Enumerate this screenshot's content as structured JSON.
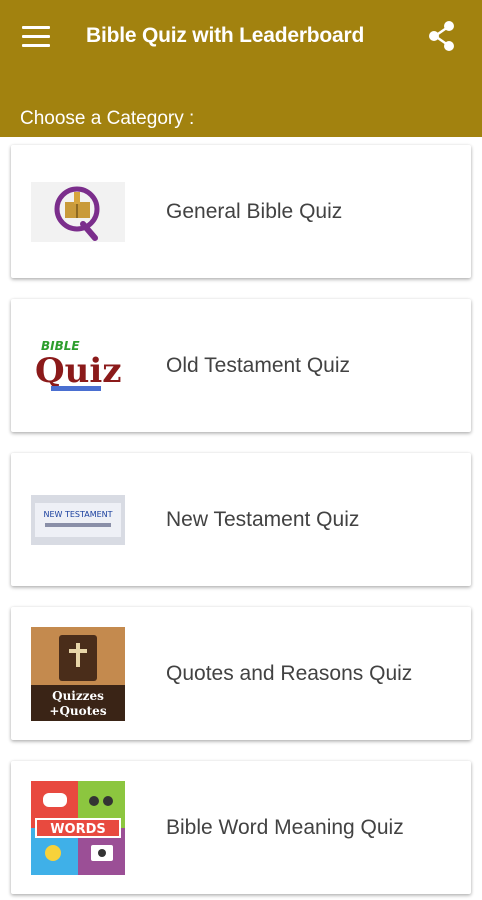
{
  "app_bar": {
    "title": "Bible Quiz with Leaderboard",
    "menu_icon": "hamburger-menu-icon",
    "share_icon": "share-icon",
    "subtitle": "Choose a Category :"
  },
  "colors": {
    "primary": "#a2820f",
    "card_text": "#424242",
    "background": "#ffffff"
  },
  "categories": [
    {
      "label": "General Bible Quiz",
      "icon": "bible-q-logo-icon"
    },
    {
      "label": "Old Testament Quiz",
      "icon": "bible-quiz-logo-icon",
      "logo_text_top": "BIBLE",
      "logo_text_main": "Quiz"
    },
    {
      "label": "New Testament Quiz",
      "icon": "new-testament-banner-icon",
      "logo_text": "NEW TESTAMENT"
    },
    {
      "label": "Quotes and Reasons Quiz",
      "icon": "quizzes-quotes-bible-icon",
      "logo_text_1": "Quizzes",
      "logo_text_2": "+Quotes"
    },
    {
      "label": "Bible Word Meaning Quiz",
      "icon": "words-game-icon",
      "logo_text": "WORDS"
    }
  ]
}
